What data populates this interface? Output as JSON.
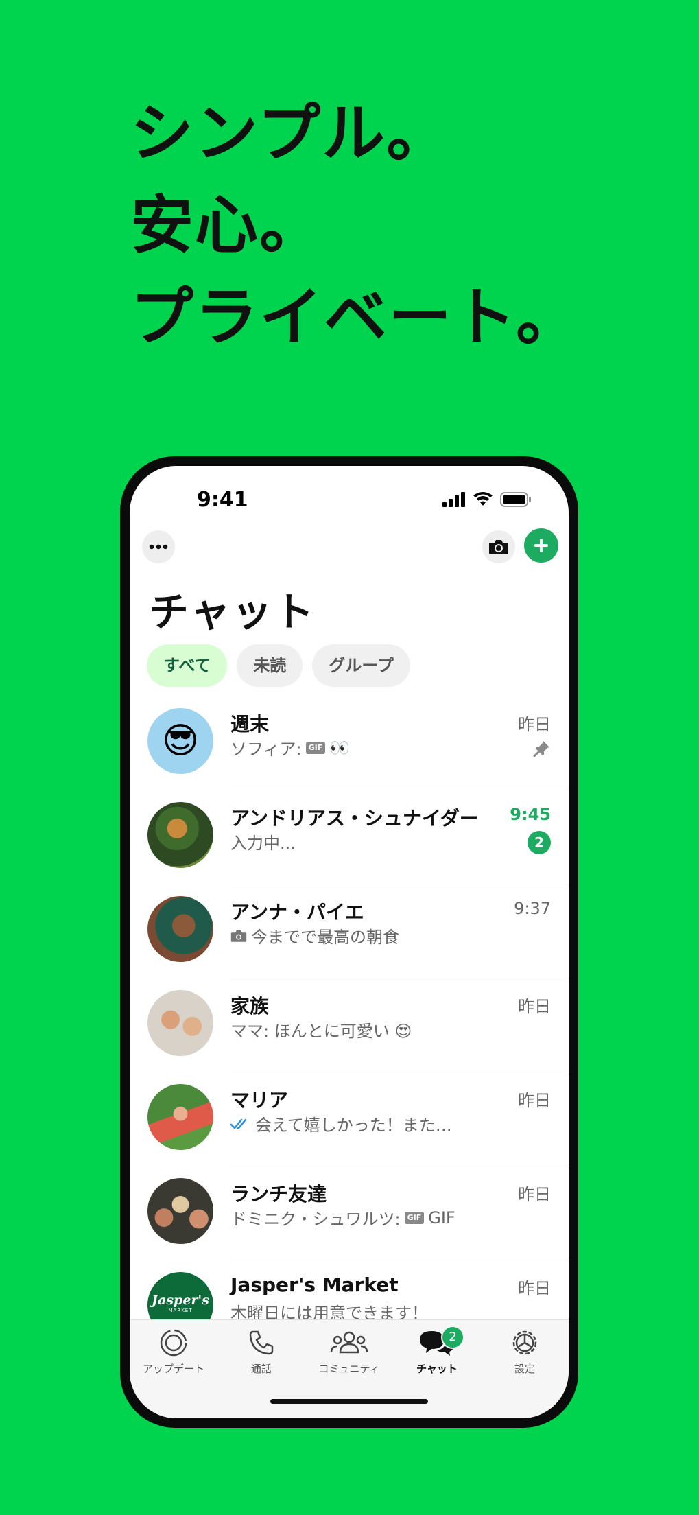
{
  "headline": {
    "line1": "シンプル。",
    "line2": "安心。",
    "line3": "プライベート。"
  },
  "status_bar": {
    "time": "9:41"
  },
  "header": {
    "title": "チャット"
  },
  "filters": [
    "すべて",
    "未読",
    "グループ"
  ],
  "chats": [
    {
      "name": "週末",
      "time": "昨日",
      "preview_prefix": "ソフィア: ",
      "gif_tag": "GIF",
      "preview": "👀"
    },
    {
      "name": "アンドリアス・シュナイダー",
      "time": "9:45",
      "preview": "入力中...",
      "unread": "2"
    },
    {
      "name": "アンナ・パイエ",
      "time": "9:37",
      "preview": "今までで最高の朝食"
    },
    {
      "name": "家族",
      "time": "昨日",
      "preview": "ママ: ほんとに可愛い 😍"
    },
    {
      "name": "マリア",
      "time": "昨日",
      "preview": "会えて嬉しかった！また…"
    },
    {
      "name": "ランチ友達",
      "time": "昨日",
      "preview_prefix": "ドミニク・シュワルツ: ",
      "gif_tag": "GIF",
      "preview": "GIF"
    },
    {
      "name": "Jasper's Market",
      "time": "昨日",
      "preview": "木曜日には用意できます！",
      "avatar_text": "Jasper's",
      "avatar_subtext": "MARKET"
    }
  ],
  "avatar_emoji": "😎",
  "tabs": [
    {
      "label": "アップデート",
      "icon": "updates-icon"
    },
    {
      "label": "通話",
      "icon": "phone-icon"
    },
    {
      "label": "コミュニティ",
      "icon": "community-icon"
    },
    {
      "label": "チャット",
      "icon": "chat-icon",
      "badge": "2"
    },
    {
      "label": "設定",
      "icon": "settings-icon"
    }
  ],
  "colors": {
    "background": "#00d44f",
    "accent": "#1daa61",
    "chip_active": "#d8fdd2"
  }
}
